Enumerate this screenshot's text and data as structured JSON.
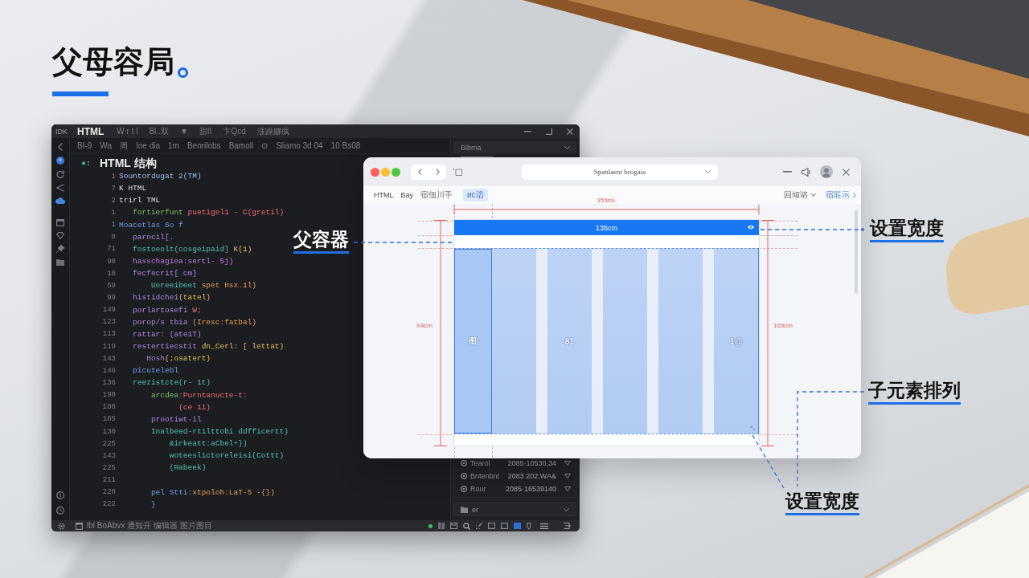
{
  "title": {
    "text": "父母容局"
  },
  "editor": {
    "app_label": "IDK",
    "file_tab": "HTML",
    "menus": [
      "W r t l",
      "Bl..双",
      "▼",
      "甜II",
      "卞Qcd",
      "涨躁娜疯"
    ],
    "toolbar": [
      "BI-9",
      "Wa",
      "周",
      "Ioe dia",
      "1m",
      "Benrilobs",
      "Bamoll",
      "⊙",
      "Sliamo 3d 04",
      "10 Bs08"
    ],
    "outline_heading": "HTML 结构",
    "code_lines": [
      {
        "number": "1",
        "segments": [
          {
            "text": "Sountordugat 2(TM)",
            "kind": "tag"
          }
        ]
      },
      {
        "number": "7",
        "segments": [
          {
            "text": "K HTML",
            "kind": "plain"
          }
        ]
      },
      {
        "number": "2",
        "segments": [
          {
            "text": "trirl TML",
            "kind": "plain"
          }
        ]
      },
      {
        "number": "1",
        "segments": [
          {
            "text": "   fortierfunt ",
            "kind": "function"
          },
          {
            "text": "puetigel1 - C(gretil)",
            "kind": "string"
          }
        ]
      },
      {
        "number": "1",
        "segments": [
          {
            "text": "Moacetlas 6o f",
            "kind": "keyword"
          }
        ]
      },
      {
        "number": "8",
        "segments": [
          {
            "text": "   parncil[.",
            "kind": "selector"
          }
        ]
      },
      {
        "number": "71",
        "segments": [
          {
            "text": "   fostoeolt(cosgeipaid] ",
            "kind": "property"
          },
          {
            "text": "K(1)",
            "kind": "argument"
          }
        ]
      },
      {
        "number": "90",
        "segments": [
          {
            "text": "   hasschagiea:sertl- 5j)",
            "kind": "attribute"
          }
        ]
      },
      {
        "number": "10",
        "segments": [
          {
            "text": "   fecfecrit[ cm]",
            "kind": "selector"
          }
        ]
      },
      {
        "number": "59",
        "segments": [
          {
            "text": "       Uoreeibeet ",
            "kind": "property"
          },
          {
            "text": "spet Hsx.1l)",
            "kind": "value"
          }
        ]
      },
      {
        "number": "99",
        "segments": [
          {
            "text": "   histidchei",
            "kind": "selector"
          },
          {
            "text": "(tatel)",
            "kind": "argument"
          }
        ]
      },
      {
        "number": "149",
        "segments": [
          {
            "text": "   porlartosefi ",
            "kind": "selector"
          },
          {
            "text": "W;",
            "kind": "string"
          }
        ]
      },
      {
        "number": "123",
        "segments": [
          {
            "text": "   porop/s tbia ",
            "kind": "selector"
          },
          {
            "text": "(Iresc:fatbal)",
            "kind": "value"
          }
        ]
      },
      {
        "number": "113",
        "segments": [
          {
            "text": "   rattar: (ate1T)",
            "kind": "selector"
          }
        ]
      },
      {
        "number": "119",
        "segments": [
          {
            "text": "   restertiecstit ",
            "kind": "selector"
          },
          {
            "text": "dn_Cerl: [ lettat)",
            "kind": "argument"
          }
        ]
      },
      {
        "number": "143",
        "segments": [
          {
            "text": "      Hosh",
            "kind": "selector"
          },
          {
            "text": "(;osatert)",
            "kind": "argument"
          }
        ]
      },
      {
        "number": "146",
        "segments": [
          {
            "text": "   picutelebl",
            "kind": "keyword"
          }
        ]
      },
      {
        "number": "136",
        "segments": [
          {
            "text": "   reezistcte(r- 1t)",
            "kind": "property"
          }
        ]
      },
      {
        "number": "190",
        "segments": [
          {
            "text": "       arcdea:",
            "kind": "function"
          },
          {
            "text": "Purntanucte-t:",
            "kind": "string"
          }
        ]
      },
      {
        "number": "180",
        "segments": [
          {
            "text": "             (ce 1i)",
            "kind": "string"
          }
        ]
      },
      {
        "number": "165",
        "segments": [
          {
            "text": "       prootiwt·il",
            "kind": "selector"
          }
        ]
      },
      {
        "number": "130",
        "segments": [
          {
            "text": "       Inalbeed-rtilttobi ddfficertt)",
            "kind": "property"
          }
        ]
      },
      {
        "number": "225",
        "segments": [
          {
            "text": "           &irkeatt:aCbel+})",
            "kind": "property"
          }
        ]
      },
      {
        "number": "143",
        "segments": [
          {
            "text": "           woteeslictoreleisi(Cottt)",
            "kind": "property"
          }
        ]
      },
      {
        "number": "225",
        "segments": [
          {
            "text": "           (Rabeek)",
            "kind": "property"
          }
        ]
      },
      {
        "number": "211"
      },
      {
        "number": "220",
        "segments": [
          {
            "text": "       pel Stti:",
            "kind": "keyword"
          },
          {
            "text": "xtpoloh:LaT-5 -{})",
            "kind": "value"
          }
        ]
      },
      {
        "number": "222",
        "segments": [
          {
            "text": "       }",
            "kind": "keyword"
          }
        ]
      }
    ],
    "panel": {
      "dropdown": "Bibma",
      "files": [
        {
          "name": "Tearol",
          "date": "2085·10530,34"
        },
        {
          "name": "Bntenbnt",
          "date": "2083 202:WA&"
        },
        {
          "name": "Rour",
          "date": "2085·16539140"
        }
      ],
      "folder": "er"
    },
    "status_text": "lbl BoAbvx 通知开 编辑器 图片图目"
  },
  "browser": {
    "address": "Spanlaent brogaia",
    "nav": [
      "HTML",
      "Bay",
      "宿佃川手"
    ],
    "badge": "ис谙",
    "actions": [
      {
        "text": "回倾谘",
        "kind": "dropdown"
      },
      {
        "text": "宿莊示",
        "kind": "link"
      }
    ]
  },
  "diagram": {
    "width_label": "355mL",
    "bar_label": "135cm",
    "left_height": "X4cm",
    "right_height": "165cm",
    "columns": [
      {
        "label": "图",
        "selected": true,
        "handle": false
      },
      {
        "selected": false,
        "handle": false
      },
      {
        "label": "81",
        "selected": false,
        "handle": false
      },
      {
        "selected": false,
        "handle": false
      },
      {
        "selected": false,
        "handle": false
      },
      {
        "label": "1@",
        "selected": false,
        "handle": true
      }
    ]
  },
  "callouts": [
    {
      "text": "父容器",
      "color": "#ffffff"
    },
    {
      "text": "设置宽度",
      "color": "#111111"
    },
    {
      "text": "子元素排列",
      "color": "#111111"
    },
    {
      "text": "设置宽度",
      "color": "#111111"
    }
  ]
}
